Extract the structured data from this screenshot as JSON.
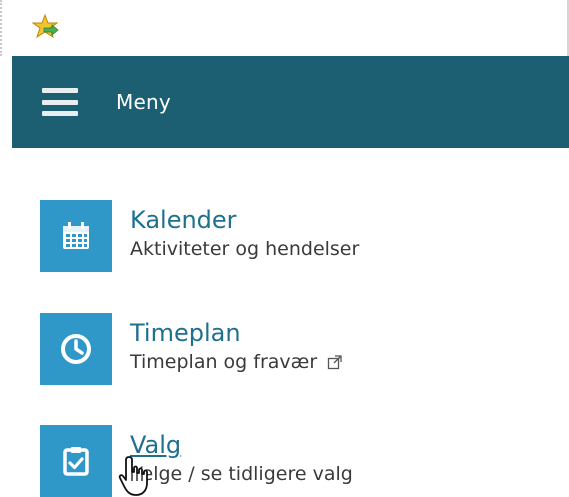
{
  "header": {
    "menu_label": "Meny"
  },
  "items": [
    {
      "title": "Kalender",
      "subtitle": "Aktiviteter og hendelser",
      "icon": "calendar-icon"
    },
    {
      "title": "Timeplan",
      "subtitle": "Timeplan og fravær",
      "icon": "clock-icon",
      "external_link_icon": "external-link-icon"
    },
    {
      "title": "Valg",
      "subtitle": "Velge / se tidligere valg",
      "icon": "checklist-icon"
    }
  ],
  "colors": {
    "menubar": "#1d5f72",
    "tile": "#2f98c9",
    "title_link": "#1f6f8f"
  }
}
